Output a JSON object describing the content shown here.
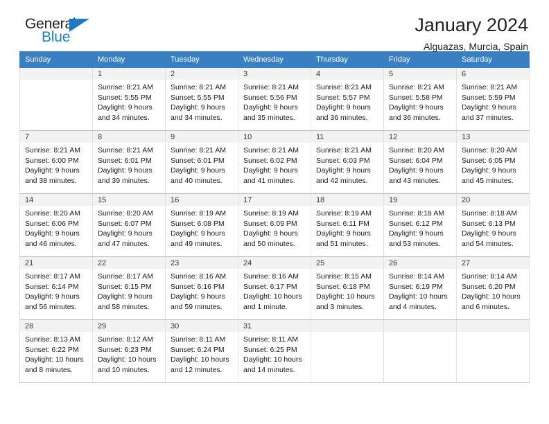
{
  "brand": {
    "name_top": "General",
    "name_bottom": "Blue"
  },
  "header": {
    "title": "January 2024",
    "location": "Alguazas, Murcia, Spain"
  },
  "colors": {
    "header_blue": "#3a7fc1",
    "logo_blue": "#1c7fc4",
    "daynum_bg": "#f2f2f2",
    "grid_line": "#bfbfbf"
  },
  "weekdays": [
    "Sunday",
    "Monday",
    "Tuesday",
    "Wednesday",
    "Thursday",
    "Friday",
    "Saturday"
  ],
  "weeks": [
    [
      {
        "day": "",
        "sunrise": "",
        "sunset": "",
        "daylight1": "",
        "daylight2": "",
        "blank": true
      },
      {
        "day": "1",
        "sunrise": "Sunrise: 8:21 AM",
        "sunset": "Sunset: 5:55 PM",
        "daylight1": "Daylight: 9 hours",
        "daylight2": "and 34 minutes."
      },
      {
        "day": "2",
        "sunrise": "Sunrise: 8:21 AM",
        "sunset": "Sunset: 5:55 PM",
        "daylight1": "Daylight: 9 hours",
        "daylight2": "and 34 minutes."
      },
      {
        "day": "3",
        "sunrise": "Sunrise: 8:21 AM",
        "sunset": "Sunset: 5:56 PM",
        "daylight1": "Daylight: 9 hours",
        "daylight2": "and 35 minutes."
      },
      {
        "day": "4",
        "sunrise": "Sunrise: 8:21 AM",
        "sunset": "Sunset: 5:57 PM",
        "daylight1": "Daylight: 9 hours",
        "daylight2": "and 36 minutes."
      },
      {
        "day": "5",
        "sunrise": "Sunrise: 8:21 AM",
        "sunset": "Sunset: 5:58 PM",
        "daylight1": "Daylight: 9 hours",
        "daylight2": "and 36 minutes."
      },
      {
        "day": "6",
        "sunrise": "Sunrise: 8:21 AM",
        "sunset": "Sunset: 5:59 PM",
        "daylight1": "Daylight: 9 hours",
        "daylight2": "and 37 minutes."
      }
    ],
    [
      {
        "day": "7",
        "sunrise": "Sunrise: 8:21 AM",
        "sunset": "Sunset: 6:00 PM",
        "daylight1": "Daylight: 9 hours",
        "daylight2": "and 38 minutes."
      },
      {
        "day": "8",
        "sunrise": "Sunrise: 8:21 AM",
        "sunset": "Sunset: 6:01 PM",
        "daylight1": "Daylight: 9 hours",
        "daylight2": "and 39 minutes."
      },
      {
        "day": "9",
        "sunrise": "Sunrise: 8:21 AM",
        "sunset": "Sunset: 6:01 PM",
        "daylight1": "Daylight: 9 hours",
        "daylight2": "and 40 minutes."
      },
      {
        "day": "10",
        "sunrise": "Sunrise: 8:21 AM",
        "sunset": "Sunset: 6:02 PM",
        "daylight1": "Daylight: 9 hours",
        "daylight2": "and 41 minutes."
      },
      {
        "day": "11",
        "sunrise": "Sunrise: 8:21 AM",
        "sunset": "Sunset: 6:03 PM",
        "daylight1": "Daylight: 9 hours",
        "daylight2": "and 42 minutes."
      },
      {
        "day": "12",
        "sunrise": "Sunrise: 8:20 AM",
        "sunset": "Sunset: 6:04 PM",
        "daylight1": "Daylight: 9 hours",
        "daylight2": "and 43 minutes."
      },
      {
        "day": "13",
        "sunrise": "Sunrise: 8:20 AM",
        "sunset": "Sunset: 6:05 PM",
        "daylight1": "Daylight: 9 hours",
        "daylight2": "and 45 minutes."
      }
    ],
    [
      {
        "day": "14",
        "sunrise": "Sunrise: 8:20 AM",
        "sunset": "Sunset: 6:06 PM",
        "daylight1": "Daylight: 9 hours",
        "daylight2": "and 46 minutes."
      },
      {
        "day": "15",
        "sunrise": "Sunrise: 8:20 AM",
        "sunset": "Sunset: 6:07 PM",
        "daylight1": "Daylight: 9 hours",
        "daylight2": "and 47 minutes."
      },
      {
        "day": "16",
        "sunrise": "Sunrise: 8:19 AM",
        "sunset": "Sunset: 6:08 PM",
        "daylight1": "Daylight: 9 hours",
        "daylight2": "and 49 minutes."
      },
      {
        "day": "17",
        "sunrise": "Sunrise: 8:19 AM",
        "sunset": "Sunset: 6:09 PM",
        "daylight1": "Daylight: 9 hours",
        "daylight2": "and 50 minutes."
      },
      {
        "day": "18",
        "sunrise": "Sunrise: 8:19 AM",
        "sunset": "Sunset: 6:11 PM",
        "daylight1": "Daylight: 9 hours",
        "daylight2": "and 51 minutes."
      },
      {
        "day": "19",
        "sunrise": "Sunrise: 8:18 AM",
        "sunset": "Sunset: 6:12 PM",
        "daylight1": "Daylight: 9 hours",
        "daylight2": "and 53 minutes."
      },
      {
        "day": "20",
        "sunrise": "Sunrise: 8:18 AM",
        "sunset": "Sunset: 6:13 PM",
        "daylight1": "Daylight: 9 hours",
        "daylight2": "and 54 minutes."
      }
    ],
    [
      {
        "day": "21",
        "sunrise": "Sunrise: 8:17 AM",
        "sunset": "Sunset: 6:14 PM",
        "daylight1": "Daylight: 9 hours",
        "daylight2": "and 56 minutes."
      },
      {
        "day": "22",
        "sunrise": "Sunrise: 8:17 AM",
        "sunset": "Sunset: 6:15 PM",
        "daylight1": "Daylight: 9 hours",
        "daylight2": "and 58 minutes."
      },
      {
        "day": "23",
        "sunrise": "Sunrise: 8:16 AM",
        "sunset": "Sunset: 6:16 PM",
        "daylight1": "Daylight: 9 hours",
        "daylight2": "and 59 minutes."
      },
      {
        "day": "24",
        "sunrise": "Sunrise: 8:16 AM",
        "sunset": "Sunset: 6:17 PM",
        "daylight1": "Daylight: 10 hours",
        "daylight2": "and 1 minute."
      },
      {
        "day": "25",
        "sunrise": "Sunrise: 8:15 AM",
        "sunset": "Sunset: 6:18 PM",
        "daylight1": "Daylight: 10 hours",
        "daylight2": "and 3 minutes."
      },
      {
        "day": "26",
        "sunrise": "Sunrise: 8:14 AM",
        "sunset": "Sunset: 6:19 PM",
        "daylight1": "Daylight: 10 hours",
        "daylight2": "and 4 minutes."
      },
      {
        "day": "27",
        "sunrise": "Sunrise: 8:14 AM",
        "sunset": "Sunset: 6:20 PM",
        "daylight1": "Daylight: 10 hours",
        "daylight2": "and 6 minutes."
      }
    ],
    [
      {
        "day": "28",
        "sunrise": "Sunrise: 8:13 AM",
        "sunset": "Sunset: 6:22 PM",
        "daylight1": "Daylight: 10 hours",
        "daylight2": "and 8 minutes."
      },
      {
        "day": "29",
        "sunrise": "Sunrise: 8:12 AM",
        "sunset": "Sunset: 6:23 PM",
        "daylight1": "Daylight: 10 hours",
        "daylight2": "and 10 minutes."
      },
      {
        "day": "30",
        "sunrise": "Sunrise: 8:11 AM",
        "sunset": "Sunset: 6:24 PM",
        "daylight1": "Daylight: 10 hours",
        "daylight2": "and 12 minutes."
      },
      {
        "day": "31",
        "sunrise": "Sunrise: 8:11 AM",
        "sunset": "Sunset: 6:25 PM",
        "daylight1": "Daylight: 10 hours",
        "daylight2": "and 14 minutes."
      },
      {
        "day": "",
        "sunrise": "",
        "sunset": "",
        "daylight1": "",
        "daylight2": "",
        "blank": true
      },
      {
        "day": "",
        "sunrise": "",
        "sunset": "",
        "daylight1": "",
        "daylight2": "",
        "blank": true
      },
      {
        "day": "",
        "sunrise": "",
        "sunset": "",
        "daylight1": "",
        "daylight2": "",
        "blank": true
      }
    ]
  ]
}
